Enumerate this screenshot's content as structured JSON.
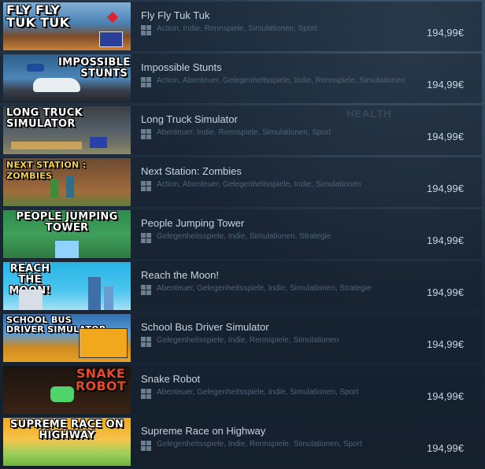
{
  "watermark": "HEALTH",
  "colors": {
    "background": "#1b2838",
    "row_bg": "#16202d",
    "title": "#c7d5e0",
    "tags": "#4f6478",
    "price": "#c7d5e0",
    "platform_icon": "#6c7f91"
  },
  "games": [
    {
      "thumb_text": "FLY FLY\nTUK TUK",
      "title": "Fly Fly Tuk Tuk",
      "platform": "windows-icon",
      "tags": "Action, Indie, Rennspiele, Simulationen, Sport",
      "price": "194,99€"
    },
    {
      "thumb_text": "IMPOSSIBLE\nSTUNTS",
      "title": "Impossible Stunts",
      "platform": "windows-icon",
      "tags": "Action, Abenteuer, Gelegenheitsspiele, Indie, Rennspiele, Simulationen",
      "price": "194,99€"
    },
    {
      "thumb_text": "LONG TRUCK\nSIMULATOR",
      "title": "Long Truck Simulator",
      "platform": "windows-icon",
      "tags": "Abenteuer, Indie, Rennspiele, Simulationen, Sport",
      "price": "194,99€"
    },
    {
      "thumb_text": "NEXT STATION : ZOMBIES",
      "title": "Next Station: Zombies",
      "platform": "windows-icon",
      "tags": "Action, Abenteuer, Gelegenheitsspiele, Indie, Simulationen",
      "price": "194,99€"
    },
    {
      "thumb_text": "PEOPLE JUMPING\nTOWER",
      "title": "People Jumping Tower",
      "platform": "windows-icon",
      "tags": "Gelegenheitsspiele, Indie, Simulationen, Strategie",
      "price": "194,99€"
    },
    {
      "thumb_text": "REACH\nTHE MOON!",
      "title": "Reach the Moon!",
      "platform": "windows-icon",
      "tags": "Abenteuer, Gelegenheitsspiele, Indie, Simulationen, Strategie",
      "price": "194,99€"
    },
    {
      "thumb_text": "SCHOOL BUS\nDRIVER SIMULATOR",
      "title": "School Bus Driver Simulator",
      "platform": "windows-icon",
      "tags": "Gelegenheitsspiele, Indie, Rennspiele, Simulationen",
      "price": "194,99€"
    },
    {
      "thumb_text": "SNAKE\nROBOT",
      "title": "Snake Robot",
      "platform": "windows-icon",
      "tags": "Abenteuer, Gelegenheitsspiele, Indie, Simulationen, Sport",
      "price": "194,99€"
    },
    {
      "thumb_text": "SUPREME RACE ON\nHIGHWAY",
      "title": "Supreme Race on Highway",
      "platform": "windows-icon",
      "tags": "Gelegenheitsspiele, Indie, Rennspiele, Simulationen, Sport",
      "price": "194,99€"
    }
  ]
}
